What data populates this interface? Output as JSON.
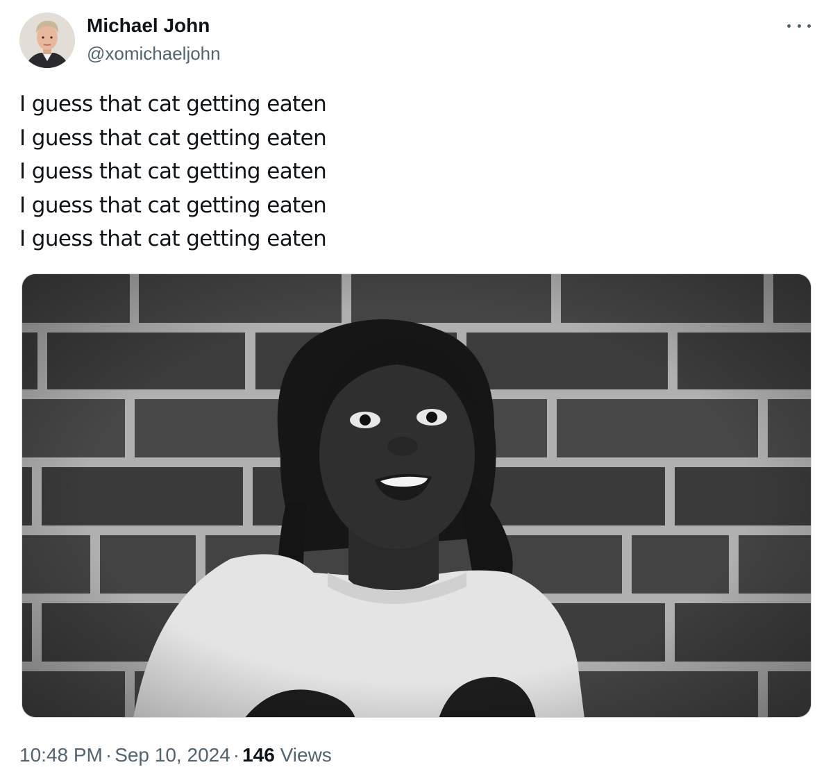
{
  "author": {
    "display_name": "Michael John",
    "handle": "@xomichaeljohn",
    "avatar_icon": "user-avatar"
  },
  "menu": {
    "icon": "more-horizontal-icon"
  },
  "tweet": {
    "lines": [
      "I guess that cat getting eaten",
      "I guess that cat getting eaten",
      "I guess that cat getting eaten",
      "I guess that cat getting eaten",
      "I guess that cat getting eaten"
    ]
  },
  "media": {
    "style": "black-and-white photo"
  },
  "meta": {
    "time": "10:48 PM",
    "separator": "·",
    "date": "Sep 10, 2024",
    "views_count": "146",
    "views_label": "Views"
  },
  "colors": {
    "text_primary": "#0f1419",
    "text_secondary": "#536471",
    "border": "#cfd9de"
  }
}
